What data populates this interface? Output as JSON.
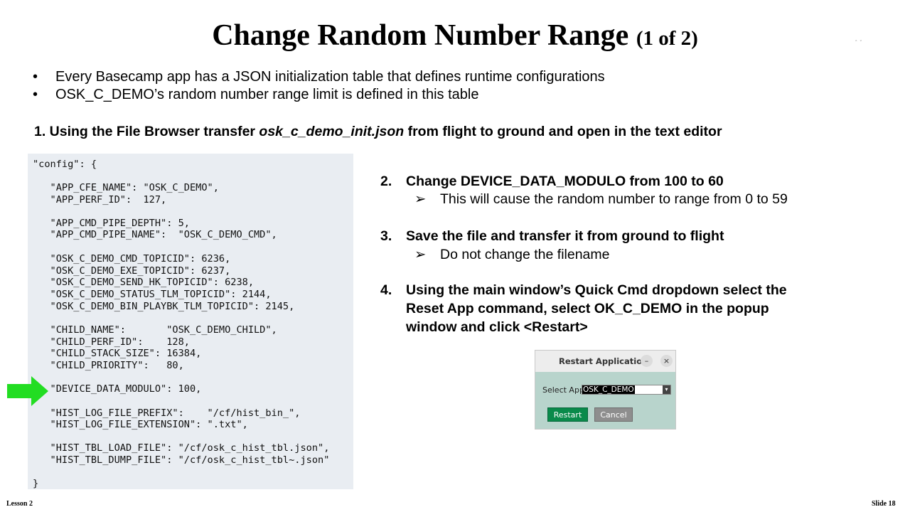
{
  "title": {
    "main": "Change Random Number Range",
    "sub": "(1 of 2)"
  },
  "corner_mark": "ﾞ ﾞ",
  "bullets": [
    "Every Basecamp app has a JSON initialization table that defines runtime configurations",
    "OSK_C_DEMO’s random number  range limit is defined in this table"
  ],
  "bullet_symbol": "•",
  "step1": {
    "prefix": "1.  Using the File Browser transfer ",
    "filename": "osk_c_demo_init.json",
    "suffix": " from flight to ground and open in the text editor"
  },
  "code_lines": [
    "\"config\": {",
    "   \"APP_CFE_NAME\": \"OSK_C_DEMO\",",
    "   \"APP_PERF_ID\":  127,",
    "   \"APP_CMD_PIPE_DEPTH\": 5,",
    "   \"APP_CMD_PIPE_NAME\":  \"OSK_C_DEMO_CMD\",",
    "   \"OSK_C_DEMO_CMD_TOPICID\": 6236,",
    "   \"OSK_C_DEMO_EXE_TOPICID\": 6237,",
    "   \"OSK_C_DEMO_SEND_HK_TOPICID\": 6238,",
    "   \"OSK_C_DEMO_STATUS_TLM_TOPICID\": 2144,",
    "   \"OSK_C_DEMO_BIN_PLAYBK_TLM_TOPICID\": 2145,",
    "   \"CHILD_NAME\":       \"OSK_C_DEMO_CHILD\",",
    "   \"CHILD_PERF_ID\":    128,",
    "   \"CHILD_STACK_SIZE\": 16384,",
    "   \"CHILD_PRIORITY\":   80,",
    "   \"DEVICE_DATA_MODULO\": 100,",
    "   \"HIST_LOG_FILE_PREFIX\":    \"/cf/hist_bin_\",",
    "   \"HIST_LOG_FILE_EXTENSION\": \".txt\",",
    "   \"HIST_TBL_LOAD_FILE\": \"/cf/osk_c_hist_tbl.json\",",
    "   \"HIST_TBL_DUMP_FILE\": \"/cf/osk_c_hist_tbl~.json\"",
    "}"
  ],
  "steps": {
    "s2": {
      "num": "2.",
      "text": "Change DEVICE_DATA_MODULO  from 100 to 60",
      "sub": "This will cause the random number  to range from 0 to 59"
    },
    "s3": {
      "num": "3.",
      "text": "Save the file and transfer it from ground to flight",
      "sub": "Do not change the filename"
    },
    "s4": {
      "num": "4.",
      "lines": [
        "Using the main window’s Quick Cmd dropdown select the",
        "Reset App command, select OK_C_DEMO in the popup",
        "window and click <Restart>"
      ]
    },
    "chevron": "➢"
  },
  "dialog": {
    "title": "Restart Application",
    "minimize": "–",
    "close": "×",
    "label": "Select App",
    "selected": "OSK_C_DEMO",
    "caret": "▾",
    "restart": "Restart",
    "cancel": "Cancel"
  },
  "footer": {
    "left": "Lesson 2",
    "right": "Slide 18"
  },
  "colors": {
    "arrow": "#22dd22",
    "code_bg": "#e9edf2",
    "restart_btn": "#0a8a4b",
    "dialog_bg": "#b8d4cc"
  }
}
